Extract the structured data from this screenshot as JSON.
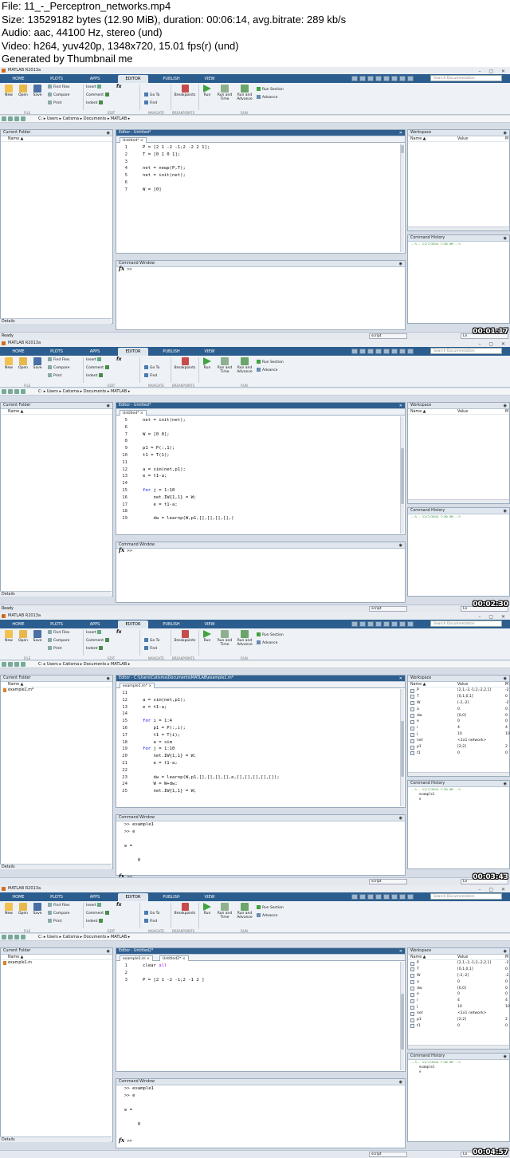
{
  "header": {
    "lines": [
      "File: 11_-_Perceptron_networks.mp4",
      "Size: 13529182 bytes (12.90 MiB), duration: 00:06:14, avg.bitrate: 289 kb/s",
      "Audio: aac, 44100 Hz, stereo (und)",
      "Video: h264, yuv420p, 1348x720, 15.01 fps(r) (und)",
      "Generated by Thumbnail me"
    ]
  },
  "common": {
    "window_title": "MATLAB R2013a",
    "tabs": [
      "HOME",
      "PLOTS",
      "APPS",
      "EDITOR",
      "PUBLISH",
      "VIEW"
    ],
    "search_placeholder": "Search Documentation",
    "ribbon": {
      "new": "New",
      "open": "Open",
      "save": "Save",
      "find_files": "Find Files",
      "compare": "Compare",
      "print": "Print",
      "insert": "Insert",
      "comment": "Comment",
      "indent": "Indent",
      "fx": "fx",
      "go_to": "Go To",
      "find": "Find",
      "breakpoints": "Breakpoints",
      "run": "Run",
      "run_and_time": "Run and Time",
      "run_and_advance": "Run and Advance",
      "run_section": "Run Section",
      "advance": "Advance",
      "groups": [
        "FILE",
        "EDIT",
        "NAVIGATE",
        "BREAKPOINTS",
        "RUN"
      ]
    },
    "current_folder": "Current Folder",
    "name_col": "Name ▲",
    "details": "Details",
    "workspace": "Workspace",
    "ws_name": "Name ▲",
    "ws_value": "Value",
    "ws_min": "M",
    "command_history": "Command History",
    "command_window": "Command Window",
    "ready": "Ready",
    "script": "script",
    "ln": "Ln",
    "history_entry": "--%-- 11/7/2014 7:30 AM --%",
    "fx_prompt": "fx",
    "cmd_prompt": ">>"
  },
  "frames": [
    {
      "timestamp": "00:01:17",
      "path": [
        "C:",
        "Users",
        "Catisma",
        "Documents",
        "MATLAB"
      ],
      "editor_title": "Editor - Untitled*",
      "doc_tabs": [
        "Untitled* ×"
      ],
      "folder_items": [],
      "code": [
        [
          "1",
          "P = [2 1 -2 -1;2 -2 2 1];"
        ],
        [
          "2",
          "T = [0 1 0 1];"
        ],
        [
          "3",
          ""
        ],
        [
          "4",
          "net = newp(P,T);"
        ],
        [
          "5",
          "net = init(net);"
        ],
        [
          "6",
          ""
        ],
        [
          "7",
          "W = [0]"
        ]
      ],
      "cmd": [],
      "workspace": [],
      "history_sub": [],
      "status_left": "Ready"
    },
    {
      "timestamp": "00:02:30",
      "path": [
        "C:",
        "Users",
        "Catisma",
        "Documents",
        "MATLAB"
      ],
      "editor_title": "Editor - Untitled*",
      "doc_tabs": [
        "Untitled* ×"
      ],
      "folder_items": [],
      "code": [
        [
          "5",
          "net = init(net);"
        ],
        [
          "6",
          ""
        ],
        [
          "7",
          "W = [0 0];"
        ],
        [
          "8",
          ""
        ],
        [
          "9",
          "p1 = P(:,1);"
        ],
        [
          "10",
          "t1 = T(1);"
        ],
        [
          "11",
          ""
        ],
        [
          "12",
          "a = sim(net,p1);"
        ],
        [
          "13",
          "e = t1-a;"
        ],
        [
          "14",
          ""
        ],
        [
          "15",
          "for j = 1:10"
        ],
        [
          "16",
          "    net.IW{1,1} = W;"
        ],
        [
          "17",
          "    e = t1-a;"
        ],
        [
          "18",
          ""
        ],
        [
          "19",
          "    dw = learnp(W,p1,[],[],[],[],)"
        ]
      ],
      "cmd": [],
      "workspace": [],
      "history_sub": [],
      "status_left": "Ready"
    },
    {
      "timestamp": "00:03:43",
      "path": [
        "C:",
        "Users",
        "Catisma",
        "Documents",
        "MATLAB"
      ],
      "editor_title": "Editor - C:\\Users\\Catisma\\Documents\\MATLAB\\example1.m*",
      "doc_tabs": [
        "example1.m* ×"
      ],
      "folder_items": [
        "example1.m*"
      ],
      "code": [
        [
          "11",
          ""
        ],
        [
          "12",
          "a = sim(net,p1);"
        ],
        [
          "13",
          "e = t1-a;"
        ],
        [
          "14",
          ""
        ],
        [
          "15",
          "for i = 1:4"
        ],
        [
          "16",
          "    p1 = P(:,i);"
        ],
        [
          "17",
          "    t1 = T(i);"
        ],
        [
          "18",
          "    a = sim"
        ],
        [
          "19",
          "for j = 1:10"
        ],
        [
          "20",
          "    net.IW{1,1} = W;"
        ],
        [
          "21",
          "    e = t1-a;"
        ],
        [
          "22",
          ""
        ],
        [
          "23",
          "    dw = learnp(W,p1,[],[],[],[],e,[],[],[],[],[]);"
        ],
        [
          "24",
          "    W = W+dw;"
        ],
        [
          "25",
          "    net.IW{1,1} = W;"
        ]
      ],
      "cmd": [
        ">> example1",
        ">> e",
        "",
        "e =",
        "",
        "     0",
        ""
      ],
      "workspace": [
        [
          "P",
          "[2,1,-2,-1;2,-2,2,1]",
          "-2"
        ],
        [
          "T",
          "[0,1,0,1]",
          "0"
        ],
        [
          "W",
          "[-2,-2]",
          "-2"
        ],
        [
          "a",
          "0",
          "0"
        ],
        [
          "dw",
          "[0,0]",
          "0"
        ],
        [
          "e",
          "0",
          "0"
        ],
        [
          "i",
          "4",
          "4"
        ],
        [
          "j",
          "10",
          "10"
        ],
        [
          "net",
          "<1x1 network>",
          ""
        ],
        [
          "p1",
          "[2;2]",
          "2"
        ],
        [
          "t1",
          "0",
          "0"
        ]
      ],
      "history_sub": [
        "example1",
        "e"
      ],
      "status_left": ""
    },
    {
      "timestamp": "00:04:57",
      "path": [
        "C:",
        "Users",
        "Catisma",
        "Documents",
        "MATLAB"
      ],
      "editor_title": "Editor - Untitled2*",
      "doc_tabs": [
        "example1.m ×",
        "Untitled2* ×"
      ],
      "folder_items": [
        "example1.m"
      ],
      "code": [
        [
          "1",
          "clear all"
        ],
        [
          "2",
          ""
        ],
        [
          "3",
          "P = [2 1 -2 -1;2 -1 2 ]"
        ]
      ],
      "cmd": [
        ">> example1",
        ">> e",
        "",
        "e =",
        "",
        "     0",
        ""
      ],
      "workspace": [
        [
          "P",
          "[2,1,-2,-1;2,-2,2,1]",
          "-2"
        ],
        [
          "T",
          "[0,1,0,1]",
          "0"
        ],
        [
          "W",
          "[-2,-2]",
          "-2"
        ],
        [
          "a",
          "0",
          "0"
        ],
        [
          "dw",
          "[0,0]",
          "0"
        ],
        [
          "e",
          "0",
          "0"
        ],
        [
          "i",
          "4",
          "4"
        ],
        [
          "j",
          "10",
          "10"
        ],
        [
          "net",
          "<1x1 network>",
          ""
        ],
        [
          "p1",
          "[2;2]",
          "2"
        ],
        [
          "t1",
          "0",
          "0"
        ]
      ],
      "history_sub": [
        "example1",
        "e"
      ],
      "status_left": ""
    }
  ]
}
